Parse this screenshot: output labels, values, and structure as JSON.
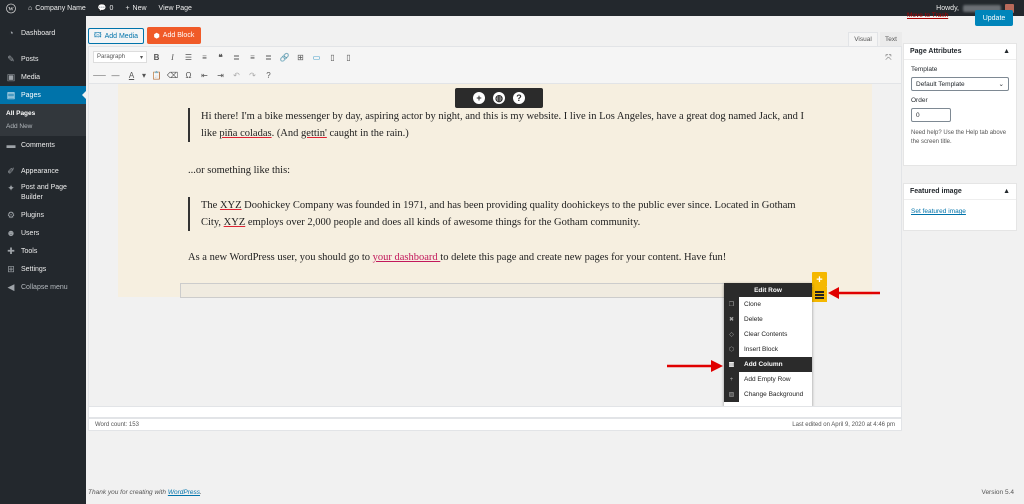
{
  "admin_bar": {
    "site_name": "Company Name",
    "comments_count": "0",
    "new_label": "New",
    "view_page_label": "View Page",
    "howdy_label": "Howdy,"
  },
  "sidebar": {
    "items": [
      {
        "label": "Dashboard",
        "icon": "dashboard-icon"
      },
      {
        "label": "Posts",
        "icon": "pin-icon"
      },
      {
        "label": "Media",
        "icon": "media-icon"
      },
      {
        "label": "Pages",
        "icon": "pages-icon"
      },
      {
        "label": "Comments",
        "icon": "comment-icon"
      },
      {
        "label": "Appearance",
        "icon": "brush-icon"
      },
      {
        "label": "Post and Page Builder",
        "icon": "builder-icon"
      },
      {
        "label": "Plugins",
        "icon": "plugin-icon"
      },
      {
        "label": "Users",
        "icon": "users-icon"
      },
      {
        "label": "Tools",
        "icon": "wrench-icon"
      },
      {
        "label": "Settings",
        "icon": "settings-icon"
      },
      {
        "label": "Collapse menu",
        "icon": "collapse-icon"
      }
    ],
    "submenu": [
      "All Pages",
      "Add New"
    ]
  },
  "editor": {
    "add_media": "Add Media",
    "add_block": "Add Block",
    "tab_visual": "Visual",
    "tab_text": "Text",
    "format_select": "Paragraph"
  },
  "content": {
    "quote1_a": "Hi there! I'm a bike messenger by day, aspiring actor by night, and this is my website. I live in Los Angeles, have a great dog named Jack, and I like ",
    "quote1_pina": "piña coladas",
    "quote1_b": ". (And ",
    "quote1_gettin": "gettin'",
    "quote1_c": " caught in the rain.)",
    "or_something": "...or something like this:",
    "quote2_a": "The ",
    "quote2_xyz": "XYZ",
    "quote2_b": " Doohickey Company was founded in 1971, and has been providing quality doohickeys to the public ever since. Located in Gotham City, ",
    "quote2_c": " employs over 2,000 people and does all kinds of awesome things for the Gotham community.",
    "final_a": "As a new WordPress user, you should go to ",
    "final_link": " your dashboard ",
    "final_b": " to delete this page and create new pages for your content. Have fun!"
  },
  "edit_row_menu": {
    "title": "Edit Row",
    "items": [
      "Clone",
      "Delete",
      "Clear Contents",
      "Insert Block",
      "Add Column",
      "Add Empty Row",
      "Change Background"
    ]
  },
  "status": {
    "word_count": "Word count: 153",
    "last_edited": "Last edited on April 9, 2020 at 4:46 pm"
  },
  "right_panel": {
    "move_to_trash": "Move to Trash",
    "update": "Update",
    "page_attributes_title": "Page Attributes",
    "template_label": "Template",
    "template_value": "Default Template",
    "order_label": "Order",
    "order_value": "0",
    "help_text": "Need help? Use the Help tab above the screen title.",
    "featured_image_title": "Featured image",
    "set_featured_image": "Set featured image"
  },
  "footer": {
    "thanks_prefix": "Thank you for creating with ",
    "wordpress": "WordPress",
    "thanks_suffix": ".",
    "version": "Version 5.4"
  },
  "colors": {
    "accent": "#0073aa",
    "add_block": "#f05a28",
    "highlight_yellow": "#f5b800",
    "arrow_red": "#e00000"
  }
}
